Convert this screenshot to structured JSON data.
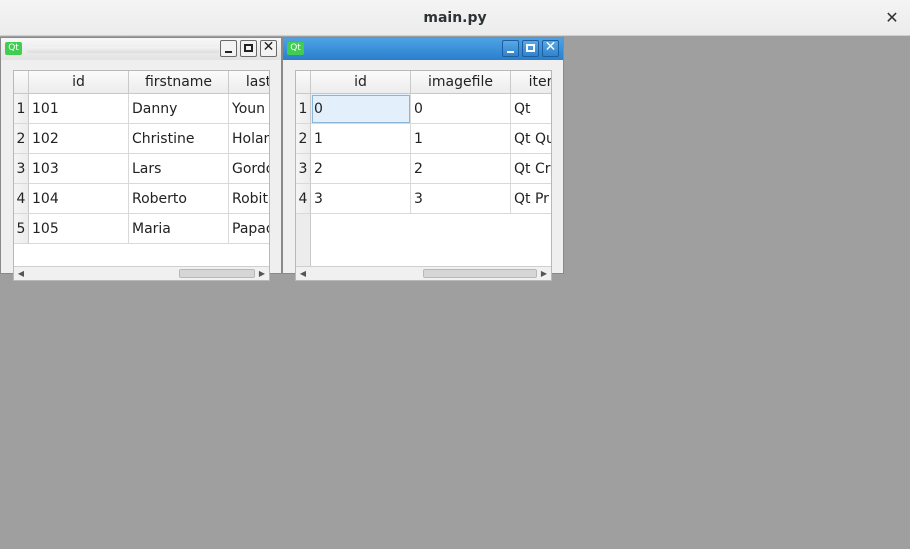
{
  "app": {
    "title": "main.py",
    "close_glyph": "✕"
  },
  "windows": [
    {
      "icon_label": "Qt",
      "columns": [
        "id",
        "firstname",
        "last"
      ],
      "rows": [
        {
          "num": "1",
          "cells": [
            "101",
            "Danny",
            "Youn"
          ]
        },
        {
          "num": "2",
          "cells": [
            "102",
            "Christine",
            "Holan"
          ]
        },
        {
          "num": "3",
          "cells": [
            "103",
            "Lars",
            "Gordo"
          ]
        },
        {
          "num": "4",
          "cells": [
            "104",
            "Roberto",
            "Robit"
          ]
        },
        {
          "num": "5",
          "cells": [
            "105",
            "Maria",
            "Papad"
          ]
        }
      ]
    },
    {
      "icon_label": "Qt",
      "columns": [
        "id",
        "imagefile",
        "iter"
      ],
      "rows": [
        {
          "num": "1",
          "cells": [
            "0",
            "0",
            "Qt"
          ]
        },
        {
          "num": "2",
          "cells": [
            "1",
            "1",
            "Qt Qu"
          ]
        },
        {
          "num": "3",
          "cells": [
            "2",
            "2",
            "Qt Cr"
          ]
        },
        {
          "num": "4",
          "cells": [
            "3",
            "3",
            "Qt Pr"
          ]
        }
      ]
    }
  ],
  "glyphs": {
    "minimize": "",
    "close": "✕",
    "scroll_left": "◀",
    "scroll_right": "▶"
  }
}
